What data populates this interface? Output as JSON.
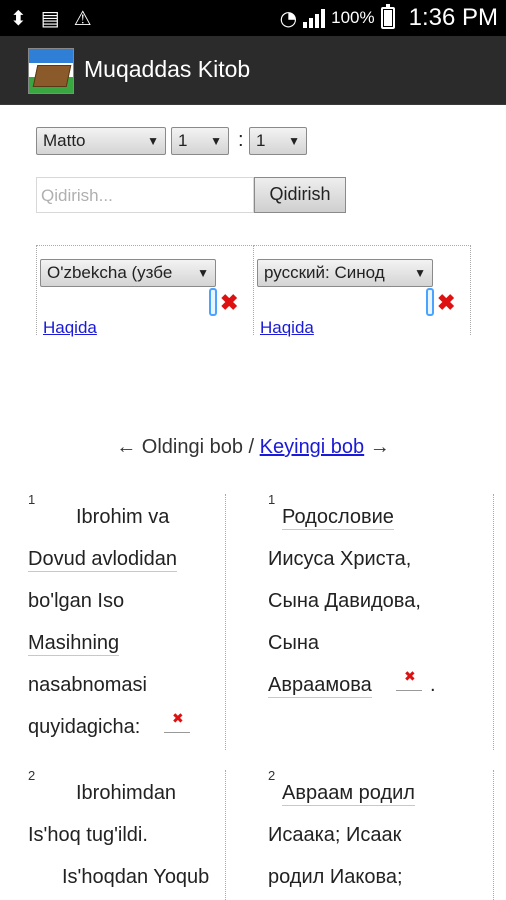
{
  "status_bar": {
    "battery_percent": "100%",
    "time": "1:36 PM",
    "icons": [
      "usb-icon",
      "sd-card-icon",
      "warning-icon",
      "wifi-icon",
      "signal-icon",
      "battery-icon"
    ]
  },
  "app": {
    "title": "Muqaddas Kitob"
  },
  "selectors": {
    "book": "Matto",
    "chapter": "1",
    "separator": ":",
    "verse": "1"
  },
  "search": {
    "placeholder": "Qidirish...",
    "button": "Qidirish"
  },
  "translations": [
    {
      "name": "O'zbekcha (узбе",
      "about": "Haqida"
    },
    {
      "name": "русский: Синод",
      "about": "Haqida"
    }
  ],
  "nav": {
    "prev_arrow": "←",
    "prev": "Oldingi bob",
    "sep": " / ",
    "next": "Keyingi bob",
    "next_arrow": "→"
  },
  "verses": [
    {
      "num": "1",
      "uz_lines": [
        "Ibrohim va",
        "Dovud avlodidan",
        "bo'lgan Iso",
        "Masihning",
        "nasabnomasi",
        "quyidagicha:"
      ],
      "ru_lines": [
        "Родословие",
        "Иисуса Христа,",
        "Сына Давидова,",
        "Сына",
        "Авраамова"
      ]
    },
    {
      "num": "2",
      "uz_lines": [
        "Ibrohimdan",
        "Is'hoq tug'ildi.",
        "Is'hoqdan Yoqub"
      ],
      "ru_lines": [
        "Авраам родил",
        "Исаака; Исаак",
        "родил Иакова;"
      ]
    }
  ],
  "colors": {
    "action_bar": "#2b2b2b",
    "link": "#1a1ad8",
    "remove": "#d11"
  }
}
